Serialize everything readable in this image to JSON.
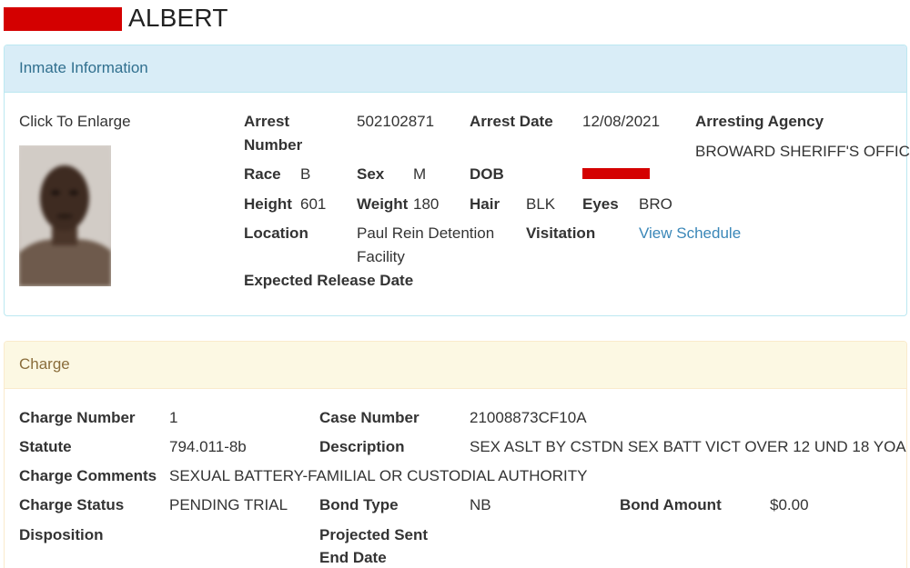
{
  "header": {
    "inmate_name": "ALBERT"
  },
  "inmate_panel": {
    "title": "Inmate Information",
    "photo_caption": "Click To Enlarge",
    "arrest_number_label_1": "Arrest",
    "arrest_number_label_2": "Number",
    "arrest_number": "502102871",
    "arrest_date_label": "Arrest Date",
    "arrest_date": "12/08/2021",
    "agency_label": "Arresting Agency",
    "agency": "BROWARD SHERIFF'S OFFICE",
    "race_label": "Race",
    "race": "B",
    "sex_label": "Sex",
    "sex": "M",
    "dob_label": "DOB",
    "height_label": "Height",
    "height": "601",
    "weight_label": "Weight",
    "weight": "180",
    "hair_label": "Hair",
    "hair": "BLK",
    "eyes_label": "Eyes",
    "eyes": "BRO",
    "location_label": "Location",
    "location_1": "Paul Rein Detention",
    "location_2": "Facility",
    "visitation_label": "Visitation",
    "visitation_link": "View Schedule",
    "release_label": "Expected Release Date"
  },
  "charge_panel": {
    "title": "Charge",
    "charge_number_label": "Charge Number",
    "charge_number": "1",
    "case_number_label": "Case Number",
    "case_number": "21008873CF10A",
    "statute_label": "Statute",
    "statute": "794.011-8b",
    "description_label": "Description",
    "description": "SEX ASLT BY CSTDN SEX BATT VICT OVER 12 UND 18 YOA",
    "comments_label": "Charge Comments",
    "comments": "SEXUAL BATTERY-FAMILIAL OR CUSTODIAL AUTHORITY",
    "status_label": "Charge Status",
    "status": "PENDING TRIAL",
    "bond_type_label": "Bond Type",
    "bond_type": "NB",
    "bond_amount_label": "Bond Amount",
    "bond_amount": "$0.00",
    "disposition_label": "Disposition",
    "projected_label_1": "Projected Sent",
    "projected_label_2": "End Date"
  },
  "colors": {
    "redaction": "#d40000",
    "info_heading_bg": "#d9edf7",
    "charge_heading_bg": "#fcf8e3",
    "link": "#3a87b8"
  }
}
